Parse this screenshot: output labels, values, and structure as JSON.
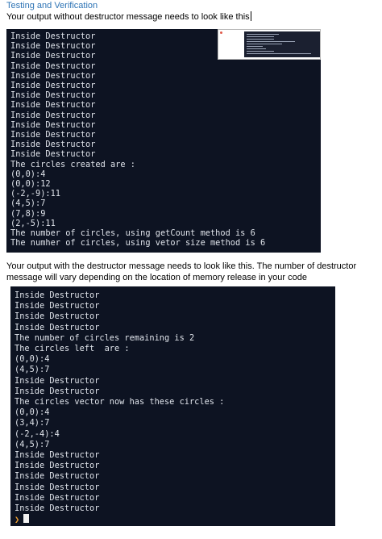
{
  "heading": "Testing and Verification",
  "intro_text": "Your output without destructor message needs to look like this",
  "terminal1_lines": [
    "Inside Destructor",
    "Inside Destructor",
    "Inside Destructor",
    "Inside Destructor",
    "Inside Destructor",
    "Inside Destructor",
    "Inside Destructor",
    "Inside Destructor",
    "Inside Destructor",
    "Inside Destructor",
    "Inside Destructor",
    "Inside Destructor",
    "Inside Destructor",
    "The circles created are :",
    "(0,0):4",
    "(0,0):12",
    "(-2,-9):11",
    "(4,5):7",
    "(7,8):9",
    "(2,-5):11",
    "The number of circles, using getCount method is 6",
    "The numher of circles, using vetor size method is 6"
  ],
  "second_text": "Your output with the destructor message needs to look like this. The number of destructor message will vary depending on the location of memory release in your code",
  "terminal2_lines": [
    "Inside Destructor",
    "Inside Destructor",
    "Inside Destructor",
    "Inside Destructor",
    "The number of circles remaining is 2",
    "The circles left  are :",
    "(0,0):4",
    "(4,5):7",
    "Inside Destructor",
    "Inside Destructor",
    "The circles vector now has these circles :",
    "(0,0):4",
    "(3,4):7",
    "(-2,-4):4",
    "(4,5):7",
    "Inside Destructor",
    "Inside Destructor",
    "Inside Destructor",
    "Inside Destructor",
    "Inside Destructor",
    "Inside Destructor"
  ],
  "prompt_symbol": "❯"
}
